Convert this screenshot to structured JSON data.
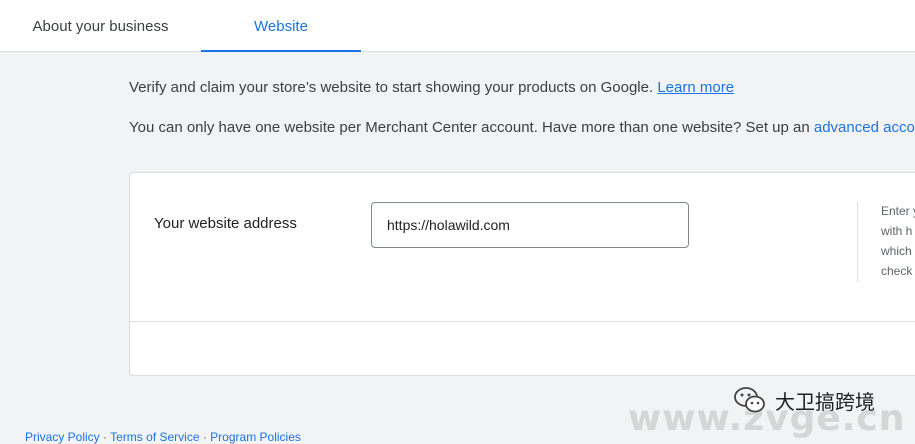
{
  "tabs": [
    {
      "label": "About your business",
      "active": false
    },
    {
      "label": "Website",
      "active": true
    }
  ],
  "intro": {
    "line1_text": "Verify and claim your store’s website to start showing your products on Google. ",
    "line1_link": "Learn more",
    "line2_text": "You can only have one website per Merchant Center account. Have more than one website? Set up an ",
    "line2_link": "advanced acco"
  },
  "website_field": {
    "label": "Your website address",
    "value": "https://holawild.com",
    "help_lines": [
      "Enter y",
      "with h",
      "which",
      "check"
    ]
  },
  "footer": {
    "links": [
      "Privacy Policy",
      "Terms of Service",
      "Program Policies"
    ],
    "separator": " · "
  },
  "watermark": {
    "text": "大卫搞跨境",
    "site": "www.zvge.cn",
    "icon": "wechat-icon"
  },
  "colors": {
    "accent": "#1a73e8",
    "text": "#3c4043",
    "background": "#f1f3f4"
  }
}
